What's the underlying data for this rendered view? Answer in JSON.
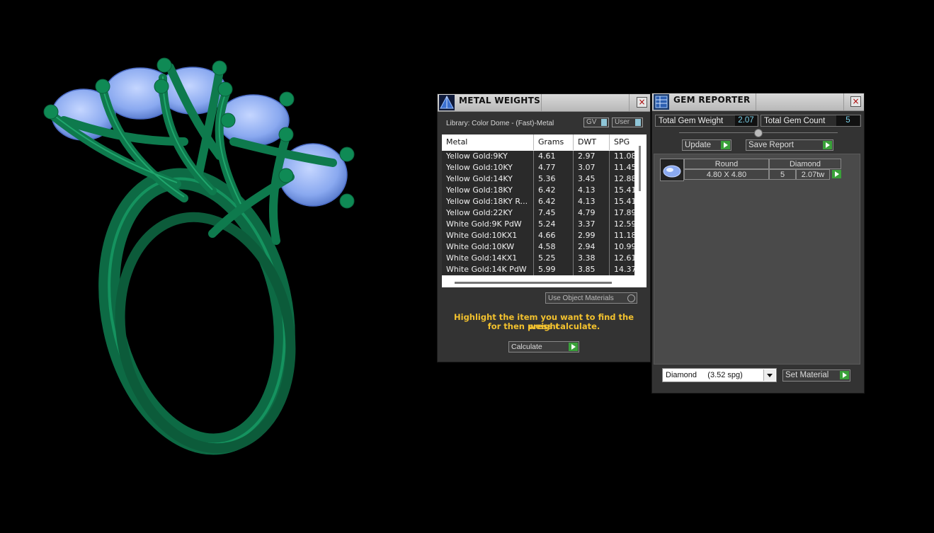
{
  "metal_weights": {
    "title": "METAL WEIGHTS",
    "close": "×",
    "library": "Library: Color Dome - (Fast)-Metal",
    "gv_label": "GV",
    "user_label": "User",
    "columns": [
      "Metal",
      "Grams",
      "DWT",
      "SPG"
    ],
    "rows": [
      [
        "Yellow Gold:9KY",
        "4.61",
        "2.97",
        "11.08"
      ],
      [
        "Yellow Gold:10KY",
        "4.77",
        "3.07",
        "11.45"
      ],
      [
        "Yellow Gold:14KY",
        "5.36",
        "3.45",
        "12.88"
      ],
      [
        "Yellow Gold:18KY",
        "6.42",
        "4.13",
        "15.41"
      ],
      [
        "Yellow Gold:18KY R...",
        "6.42",
        "4.13",
        "15.41"
      ],
      [
        "Yellow Gold:22KY",
        "7.45",
        "4.79",
        "17.89"
      ],
      [
        "White Gold:9K PdW",
        "5.24",
        "3.37",
        "12.59"
      ],
      [
        "White Gold:10KX1",
        "4.66",
        "2.99",
        "11.18"
      ],
      [
        "White Gold:10KW",
        "4.58",
        "2.94",
        "10.99"
      ],
      [
        "White Gold:14KX1",
        "5.25",
        "3.38",
        "12.61"
      ],
      [
        "White Gold:14K PdW",
        "5.99",
        "3.85",
        "14.37"
      ]
    ],
    "use_object_materials": "Use Object Materials",
    "hint_line1": "Highlight the item you want to find the weight",
    "hint_line2": "for then press calculate.",
    "calculate": "Calculate"
  },
  "gem_reporter": {
    "title": "GEM REPORTER",
    "close": "×",
    "total_weight_label": "Total Gem Weight",
    "total_weight_value": "2.07",
    "total_count_label": "Total Gem Count",
    "total_count_value": "5",
    "update": "Update",
    "save_report": "Save Report",
    "gem": {
      "shape": "Round",
      "material": "Diamond",
      "size": "4.80 X 4.80",
      "count": "5",
      "weight": "2.07tw"
    },
    "material_select": "Diamond     (3.52 spg)",
    "set_material": "Set Material"
  },
  "icons": [
    "pyramid-icon",
    "gem-icon",
    "close-icon",
    "play-icon",
    "dropdown-arrow-icon"
  ],
  "colors": {
    "ring_metal": "#0f7a4e",
    "gem": "#8fb4f5",
    "panel": "#333333",
    "hint": "#f2c12e",
    "value_text": "#7ad0e8",
    "accent_green": "#3aa13a"
  }
}
